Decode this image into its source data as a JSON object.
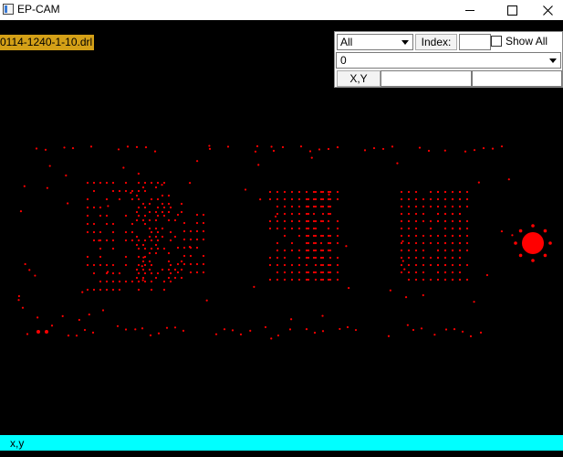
{
  "window": {
    "title": "EP-CAM",
    "icon": "app-window-icon"
  },
  "file": {
    "name": "0114-1240-1-10.drl"
  },
  "controls": {
    "filter_select": "All",
    "index_label": "Index:",
    "index_value": "",
    "show_all_label": "Show All",
    "show_all_checked": false,
    "value_select": "0",
    "xy_label": "X,Y",
    "x_value": "",
    "y_value": ""
  },
  "status": {
    "text": "x,y"
  },
  "colors": {
    "canvas_bg": "#000000",
    "drill": "#ff0000",
    "file_label_bg": "#d4a017",
    "status_bg": "#00ffff"
  }
}
